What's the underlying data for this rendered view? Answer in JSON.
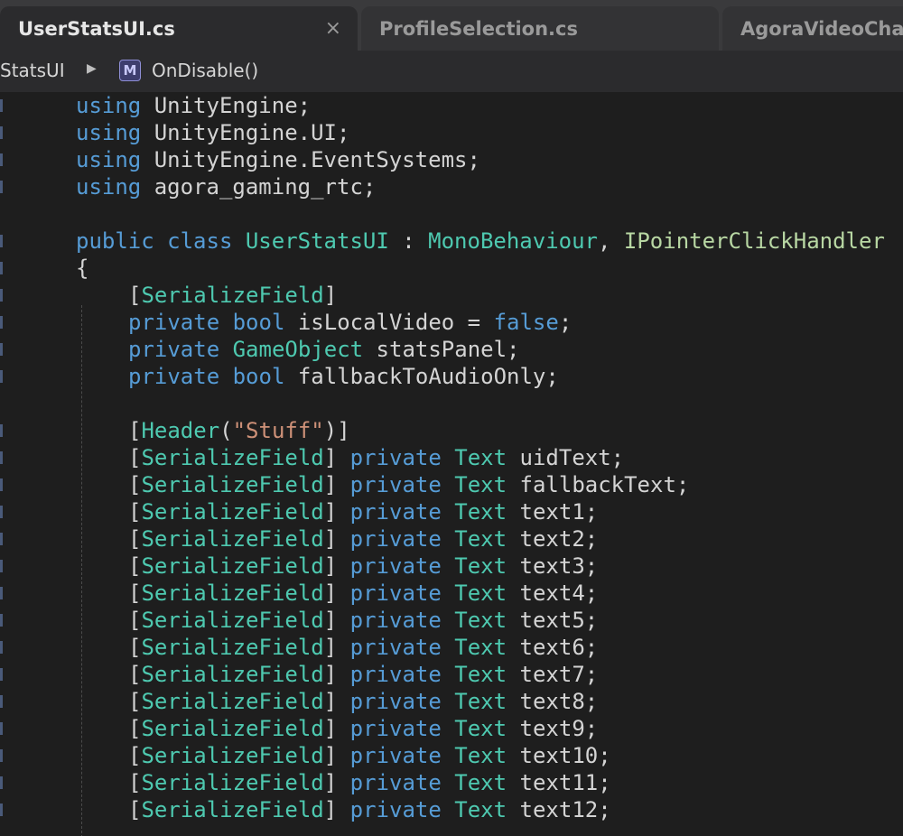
{
  "tabs": [
    {
      "label": "UserStatsUI.cs",
      "active": true,
      "close": "×"
    },
    {
      "label": "ProfileSelection.cs",
      "active": false
    },
    {
      "label": "AgoraVideoChat",
      "active": false
    }
  ],
  "breadcrumb": {
    "class_name": "StatsUI",
    "separator": "▶",
    "method_badge": "M",
    "method_name": "OnDisable()"
  },
  "code": {
    "using1": {
      "kw": "using",
      "ns": " UnityEngine;"
    },
    "using2": {
      "kw": "using",
      "ns": " UnityEngine.UI;"
    },
    "using3": {
      "kw": "using",
      "ns": " UnityEngine.EventSystems;"
    },
    "using4": {
      "kw": "using",
      "ns": " agora_gaming_rtc;"
    },
    "class_decl": {
      "mods": "public class ",
      "name": "UserStatsUI",
      "colon": " : ",
      "base": "MonoBehaviour",
      "comma": ", ",
      "iface": "IPointerClickHandler"
    },
    "open_brace": "{",
    "attr_serialize": "SerializeField",
    "field_islocal": {
      "kw": "private bool",
      "rest": " isLocalVideo = ",
      "val": "false",
      "end": ";"
    },
    "field_stats": {
      "kw": "private",
      "type": "GameObject",
      "rest": " statsPanel;"
    },
    "field_fallback": {
      "kw": "private bool",
      "rest": " fallbackToAudioOnly;"
    },
    "header_attr": {
      "name": "Header",
      "arg": "\"Stuff\""
    },
    "text_fields": [
      "uidText;",
      "fallbackText;",
      "text1;",
      "text2;",
      "text3;",
      "text4;",
      "text5;",
      "text6;",
      "text7;",
      "text8;",
      "text9;",
      "text10;",
      "text11;",
      "text12;"
    ],
    "text_field_kw": "private",
    "text_field_type": "Text"
  },
  "colors": {
    "keyword": "#569cd6",
    "type": "#4ec9b0",
    "interface": "#b8d7a3",
    "string": "#ce9178",
    "text": "#d4d4d4",
    "background": "#1e1e1e"
  }
}
